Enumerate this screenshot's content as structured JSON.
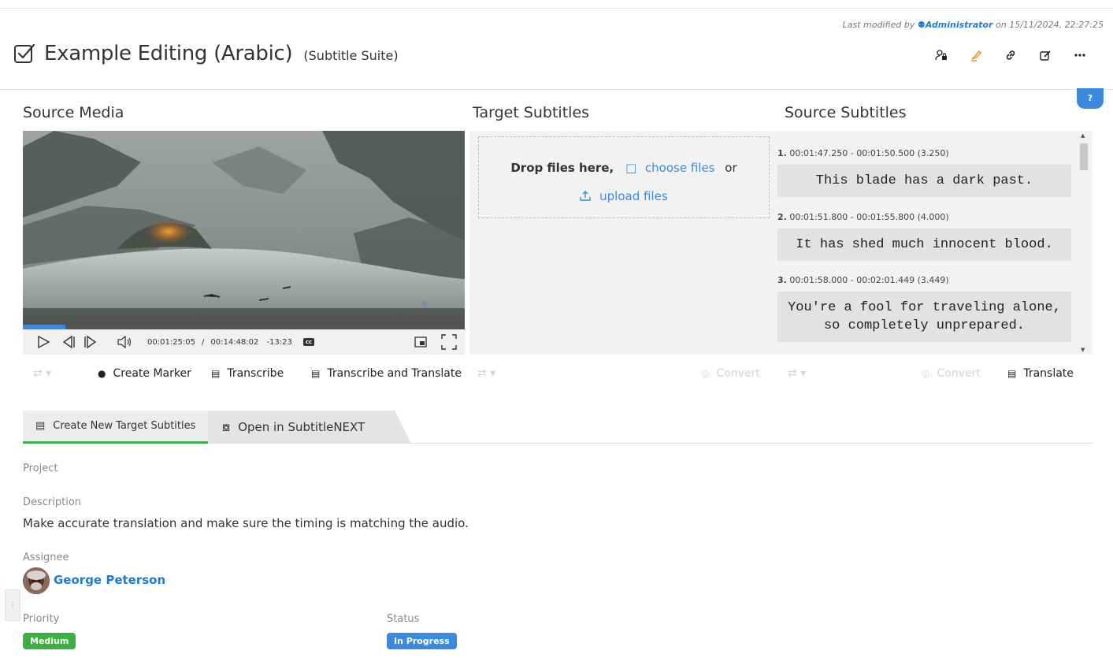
{
  "header": {
    "modified_prefix": "Last modified by",
    "modified_user": "Administrator",
    "modified_suffix": "on 15/11/2024, 22:27:25",
    "title": "Example Editing (Arabic)",
    "type": "(Subtitle Suite)",
    "help": "?"
  },
  "columns": {
    "source_media": "Source Media",
    "target_subtitles": "Target Subtitles",
    "source_subtitles": "Source Subtitles"
  },
  "player": {
    "progress": 0.097,
    "current_time": "00:01:25:05",
    "separator": "/",
    "duration": "00:14:48:02",
    "remaining": "-13:23",
    "cc_label": "cc"
  },
  "dropzone": {
    "drop_text": "Drop files here,",
    "choose_files": "choose files",
    "or": "or",
    "upload_files": "upload files"
  },
  "source_cues": [
    {
      "num": "1.",
      "time": "00:01:47.250 - 00:01:50.500 (3.250)",
      "text": "This blade has a dark past."
    },
    {
      "num": "2.",
      "time": "00:01:51.800 - 00:01:55.800 (4.000)",
      "text": "It has shed much innocent blood."
    },
    {
      "num": "3.",
      "time": "00:01:58.000 - 00:02:01.449 (3.449)",
      "text": "You're a fool for traveling alone,\nso completely unprepared."
    }
  ],
  "toolbar": {
    "create_marker": "Create Marker",
    "transcribe": "Transcribe",
    "transcribe_translate": "Transcribe and Translate",
    "convert": "Convert",
    "convert2": "Convert",
    "translate": "Translate"
  },
  "tabs": {
    "create_new": "Create New Target Subtitles",
    "open_next": "Open in SubtitleNEXT"
  },
  "details": {
    "project_label": "Project",
    "description_label": "Description",
    "description": "Make accurate translation and make sure the timing is matching the audio.",
    "assignee_label": "Assignee",
    "assignee": "George Peterson",
    "priority_label": "Priority",
    "priority": "Medium",
    "status_label": "Status",
    "status": "In Progress"
  },
  "colors": {
    "accent": "#3a8be0",
    "link": "#1f7ad6",
    "priority_medium": "#3cb043",
    "status_in_progress": "#3a8be0",
    "tab_active_underline": "#3cb043"
  },
  "icons": [
    "user-icon",
    "checkbox-icon",
    "user-lock-icon",
    "highlighter-icon",
    "link-icon",
    "edit-icon",
    "more-icon",
    "play-icon",
    "step-back-icon",
    "step-forward-icon",
    "volume-icon",
    "pip-icon",
    "fullscreen-icon",
    "folder-icon",
    "upload-icon",
    "shuffle-icon",
    "pin-icon",
    "transcribe-icon",
    "translate-icon",
    "convert-icon",
    "subtitles-icon",
    "subtitlenext-icon"
  ]
}
